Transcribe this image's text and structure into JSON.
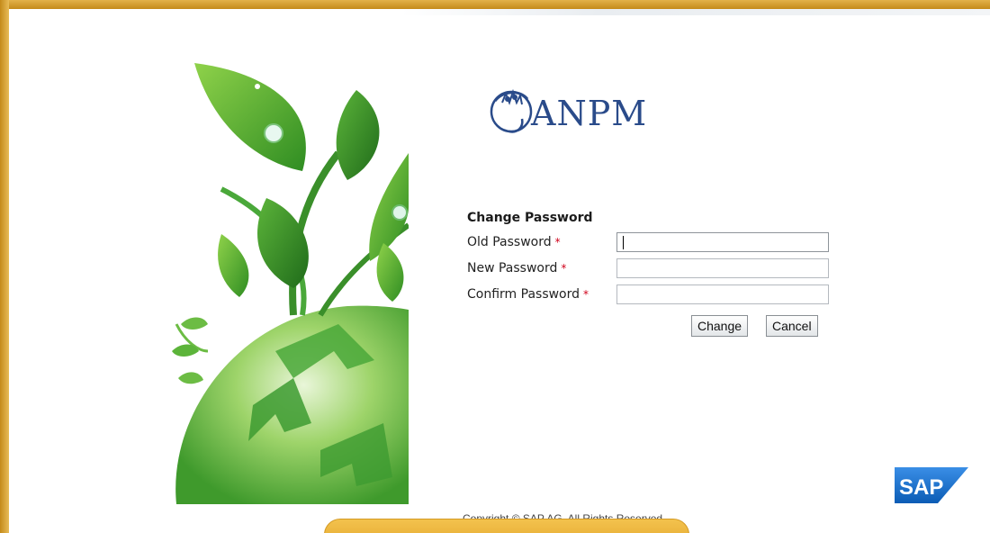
{
  "brand": {
    "logo_text": "ANPM",
    "sap_logo_text": "SAP"
  },
  "form": {
    "title": "Change Password",
    "required_marker": "*",
    "fields": [
      {
        "label": "Old Password",
        "value": "",
        "focused": true
      },
      {
        "label": "New Password",
        "value": ""
      },
      {
        "label": "Confirm Password",
        "value": ""
      }
    ],
    "change_label": "Change",
    "cancel_label": "Cancel"
  },
  "footer": {
    "copyright": "Copyright © SAP AG. All Rights Reserved."
  },
  "colors": {
    "frame": "#d9a030",
    "required": "#d0021b",
    "logo": "#2a4b8a",
    "sap_blue": "#1a6fc9"
  }
}
